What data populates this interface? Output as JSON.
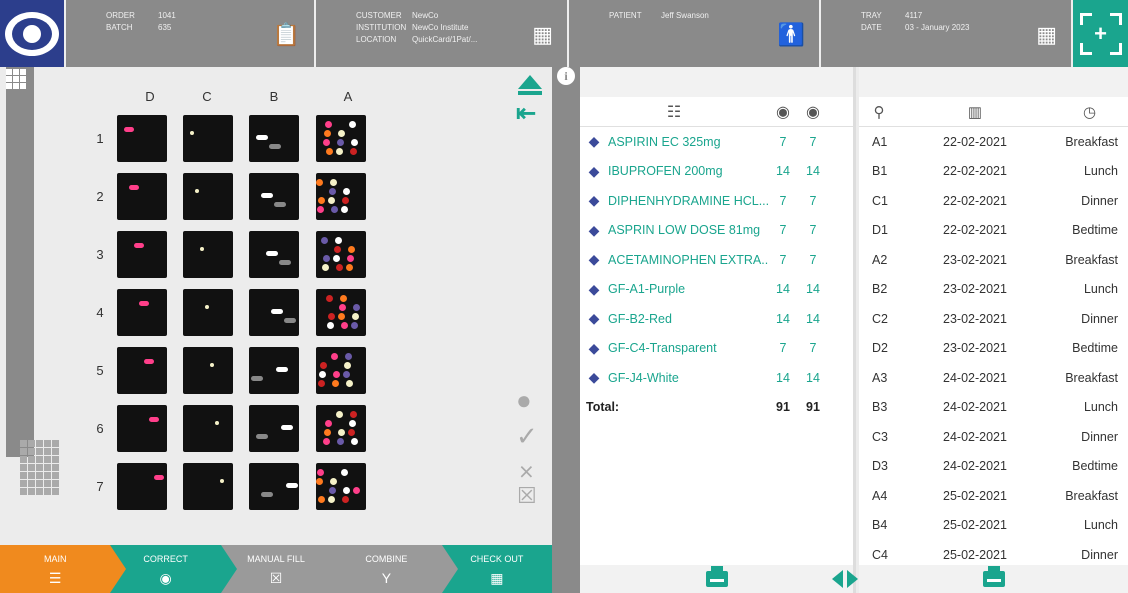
{
  "header": {
    "order_label": "ORDER",
    "order": "1041",
    "batch_label": "BATCH",
    "batch": "635",
    "customer_label": "CUSTOMER",
    "customer": "NewCo",
    "institution_label": "INSTITUTION",
    "institution": "NewCo Institute",
    "location_label": "LOCATION",
    "location": "QuickCard/1Pat/...",
    "patient_label": "PATIENT",
    "patient": "Jeff Swanson",
    "tray_label": "TRAY",
    "tray": "4117",
    "date_label": "DATE",
    "date": "03 - January 2023"
  },
  "tray": {
    "columns": [
      "D",
      "C",
      "B",
      "A"
    ],
    "rows": [
      "1",
      "2",
      "3",
      "4",
      "5",
      "6",
      "7"
    ]
  },
  "nav": [
    {
      "label": "MAIN",
      "icon": "main-icon"
    },
    {
      "label": "CORRECT",
      "icon": "pill-icon"
    },
    {
      "label": "MANUAL FILL",
      "icon": "manual-fill-icon"
    },
    {
      "label": "COMBINE",
      "icon": "combine-icon"
    },
    {
      "label": "CHECK OUT",
      "icon": "checkout-icon"
    }
  ],
  "meds": {
    "items": [
      {
        "name": "ASPIRIN EC 325mg",
        "q1": "7",
        "q2": "7"
      },
      {
        "name": "IBUPROFEN 200mg",
        "q1": "14",
        "q2": "14"
      },
      {
        "name": "DIPHENHYDRAMINE HCL...",
        "q1": "7",
        "q2": "7"
      },
      {
        "name": "ASPRIN LOW DOSE 81mg",
        "q1": "7",
        "q2": "7"
      },
      {
        "name": "ACETAMINOPHEN EXTRA...",
        "q1": "7",
        "q2": "7"
      },
      {
        "name": "GF-A1-Purple",
        "q1": "14",
        "q2": "14"
      },
      {
        "name": "GF-B2-Red",
        "q1": "14",
        "q2": "14"
      },
      {
        "name": "GF-C4-Transparent",
        "q1": "7",
        "q2": "7"
      },
      {
        "name": "GF-J4-White",
        "q1": "14",
        "q2": "14"
      }
    ],
    "total_label": "Total:",
    "total1": "91",
    "total2": "91"
  },
  "schedule": [
    {
      "cell": "A1",
      "date": "22-02-2021",
      "time": "Breakfast"
    },
    {
      "cell": "B1",
      "date": "22-02-2021",
      "time": "Lunch"
    },
    {
      "cell": "C1",
      "date": "22-02-2021",
      "time": "Dinner"
    },
    {
      "cell": "D1",
      "date": "22-02-2021",
      "time": "Bedtime"
    },
    {
      "cell": "A2",
      "date": "23-02-2021",
      "time": "Breakfast"
    },
    {
      "cell": "B2",
      "date": "23-02-2021",
      "time": "Lunch"
    },
    {
      "cell": "C2",
      "date": "23-02-2021",
      "time": "Dinner"
    },
    {
      "cell": "D2",
      "date": "23-02-2021",
      "time": "Bedtime"
    },
    {
      "cell": "A3",
      "date": "24-02-2021",
      "time": "Breakfast"
    },
    {
      "cell": "B3",
      "date": "24-02-2021",
      "time": "Lunch"
    },
    {
      "cell": "C3",
      "date": "24-02-2021",
      "time": "Dinner"
    },
    {
      "cell": "D3",
      "date": "24-02-2021",
      "time": "Bedtime"
    },
    {
      "cell": "A4",
      "date": "25-02-2021",
      "time": "Breakfast"
    },
    {
      "cell": "B4",
      "date": "25-02-2021",
      "time": "Lunch"
    },
    {
      "cell": "C4",
      "date": "25-02-2021",
      "time": "Dinner"
    }
  ],
  "colors": {
    "accent": "#1aa58e",
    "orange": "#f08a1e",
    "header": "#8a8a8a",
    "brand": "#2c3e8c"
  }
}
